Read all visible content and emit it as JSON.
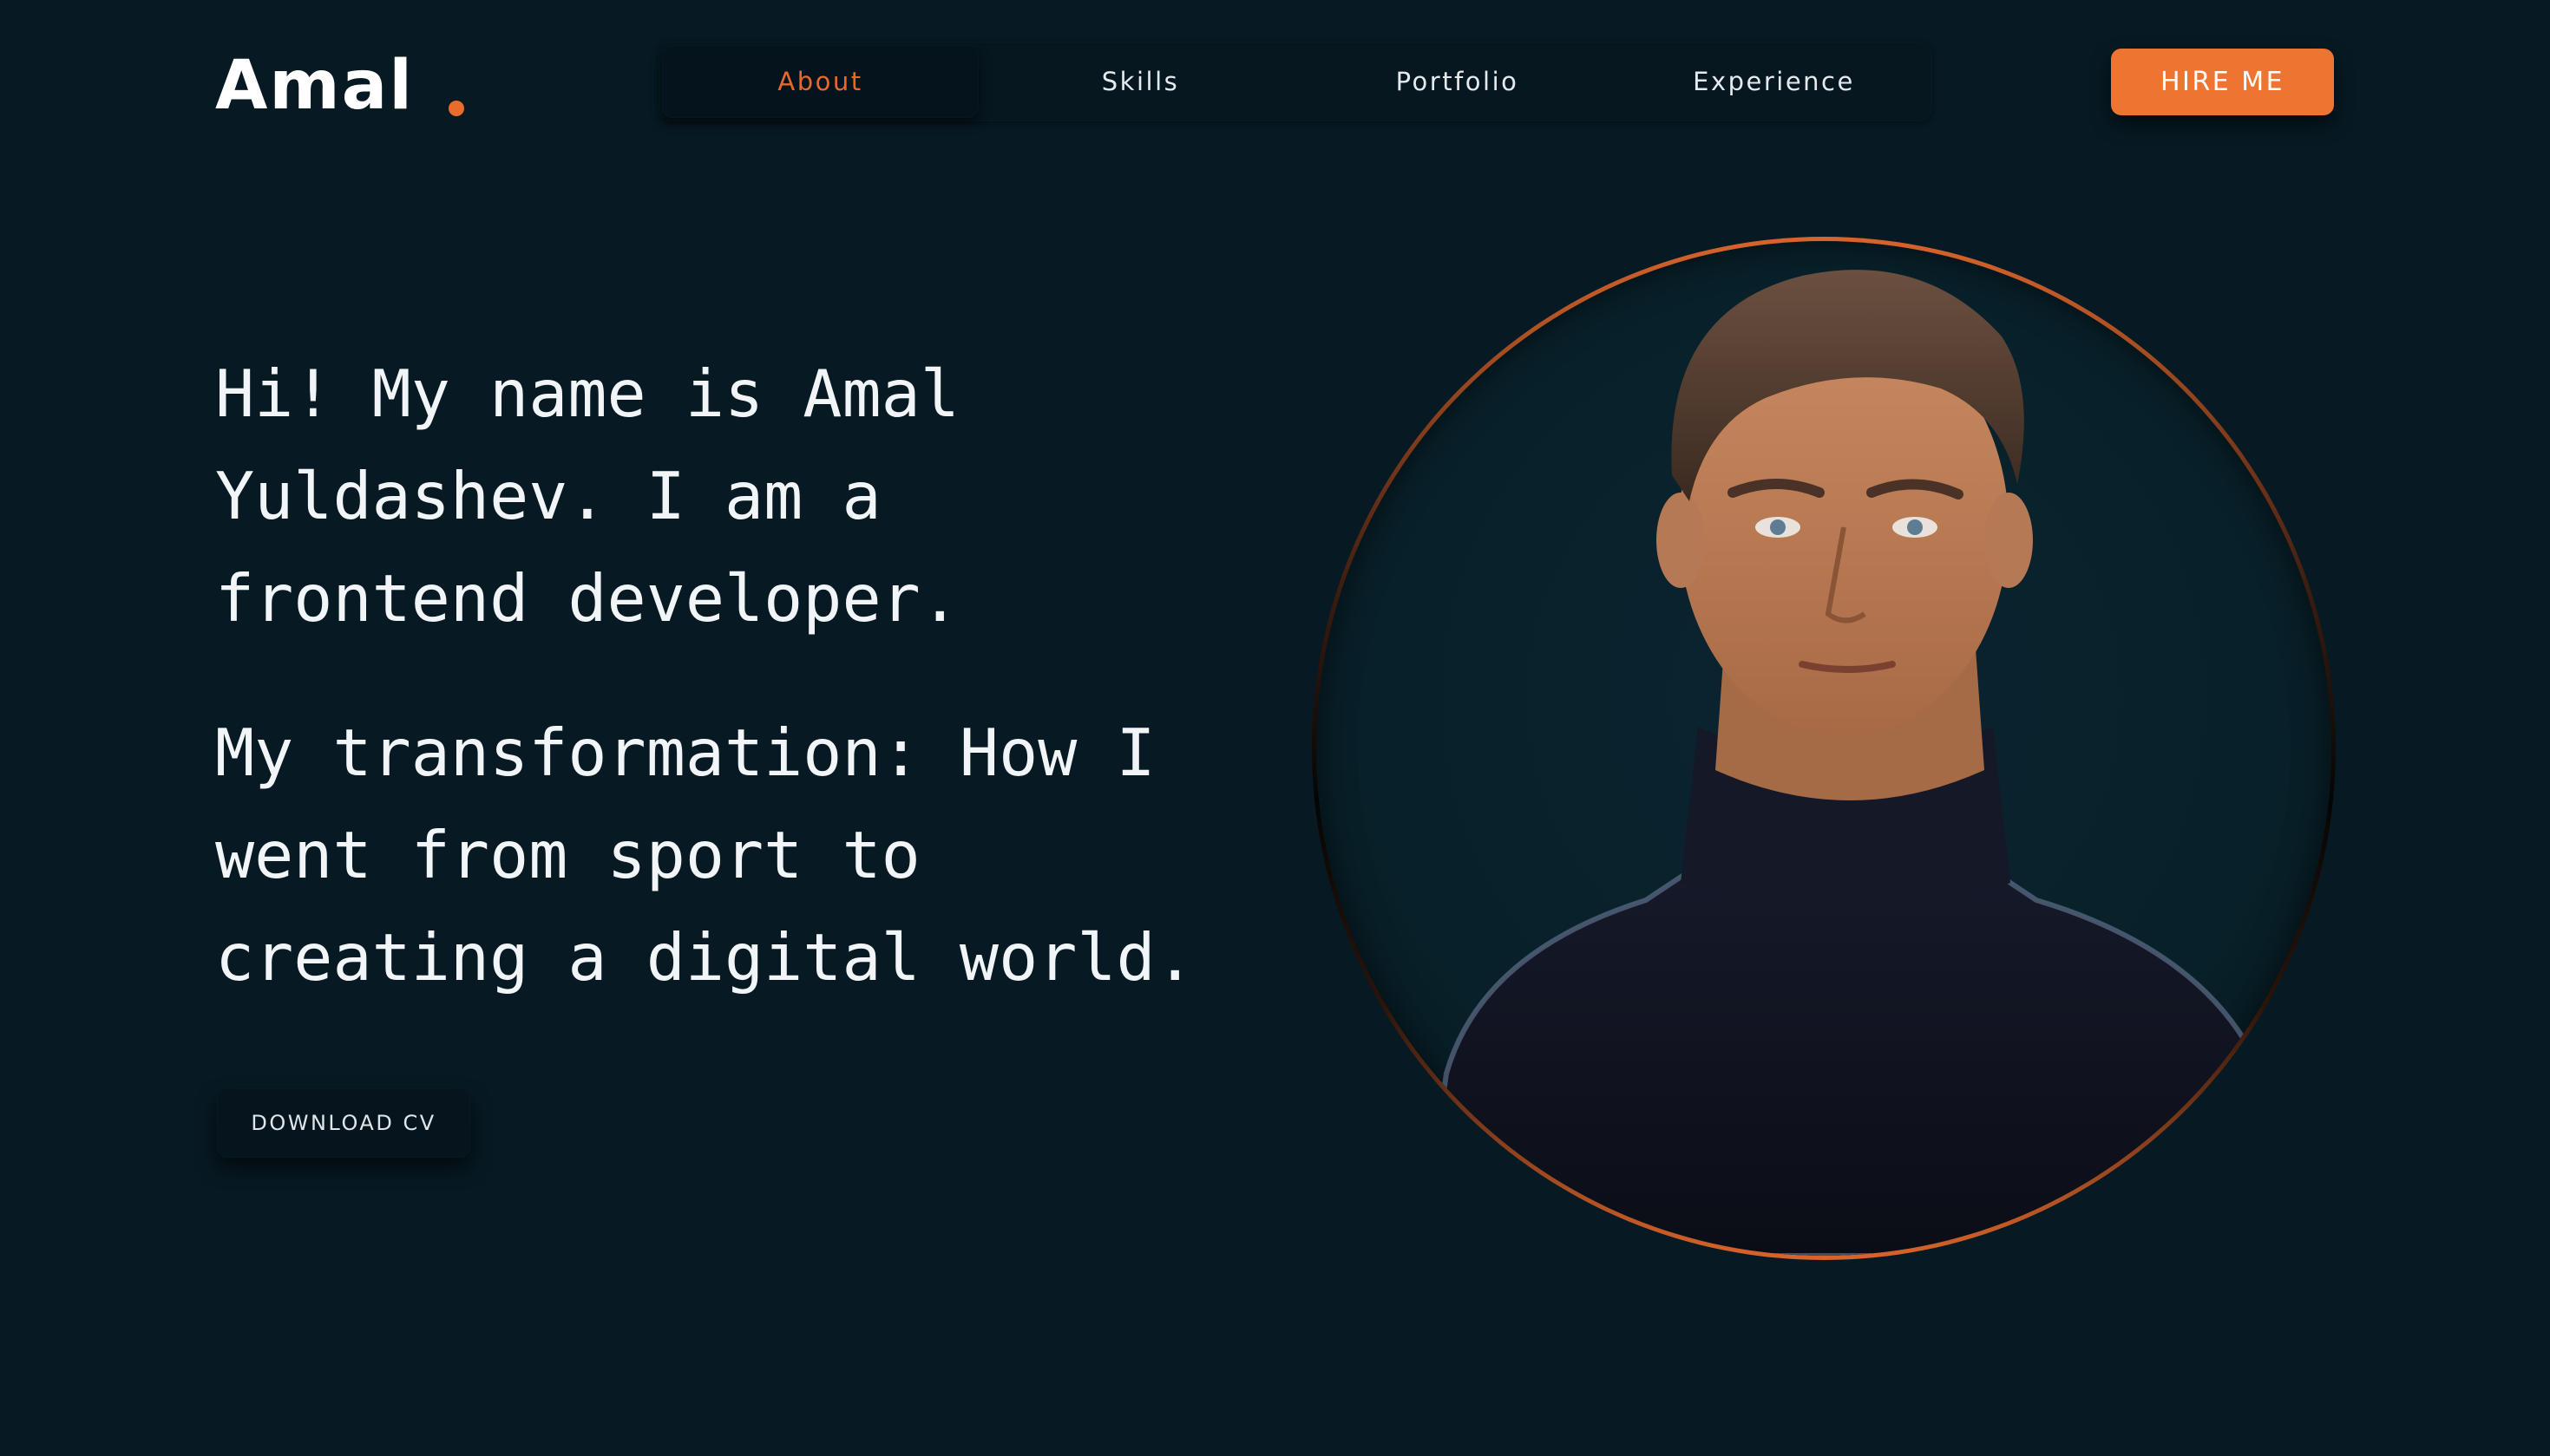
{
  "header": {
    "logo_text": "Amal",
    "nav": [
      {
        "label": "About",
        "active": true
      },
      {
        "label": "Skills",
        "active": false
      },
      {
        "label": "Portfolio",
        "active": false
      },
      {
        "label": "Experience",
        "active": false
      }
    ],
    "hire_label": "HIRE ME"
  },
  "hero": {
    "intro": "Hi! My name is Amal\nYuldashev. I am a\nfrontend developer.",
    "story": "My transformation: How I\nwent from sport to\ncreating a digital world.",
    "download_label": "DOWNLOAD CV"
  },
  "portrait": {
    "icon": "person-portrait"
  },
  "colors": {
    "background": "#071922",
    "accent": "#ee7432",
    "nav_active_text": "#e5692c",
    "text": "#f2f5f7"
  }
}
